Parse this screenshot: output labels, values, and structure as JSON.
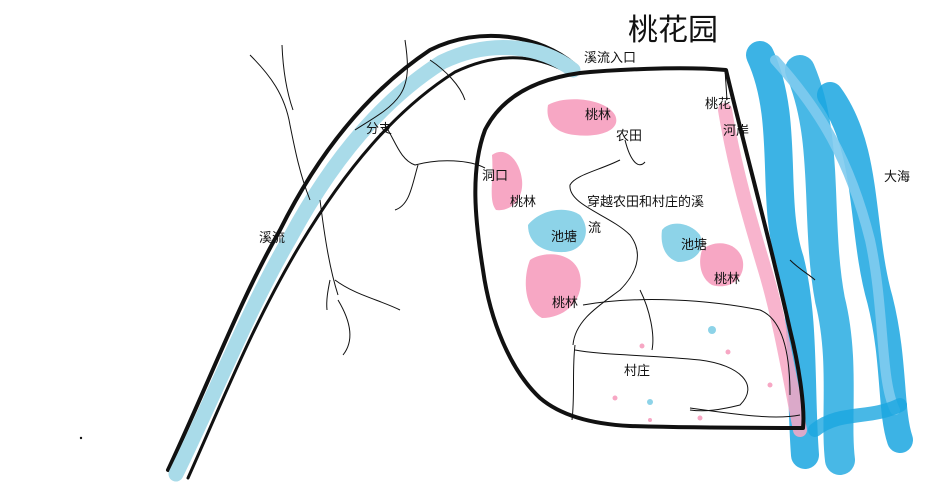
{
  "labels": {
    "title": "桃花园",
    "stream_entrance": "溪流入口",
    "branch": "分支",
    "stream": "溪流",
    "cave_mouth": "洞口",
    "peach_grove_top": "桃林",
    "peach_grove_left": "桃林",
    "peach_grove_center": "桃林",
    "peach_grove_right": "桃林",
    "farmland": "农田",
    "peach_bank_1": "桃花",
    "peach_bank_2": "河岸",
    "cross_stream": "穿越农田和村庄的溪",
    "flow": "流",
    "pond_left": "池塘",
    "pond_right": "池塘",
    "village": "村庄",
    "sea": "大海"
  },
  "colors": {
    "stream": "#a9dbe9",
    "sea": "#1aa6e0",
    "sea_light": "#7fcbee",
    "peach": "#f7a7c4",
    "pond": "#8dd3e8",
    "outline": "#111111"
  }
}
